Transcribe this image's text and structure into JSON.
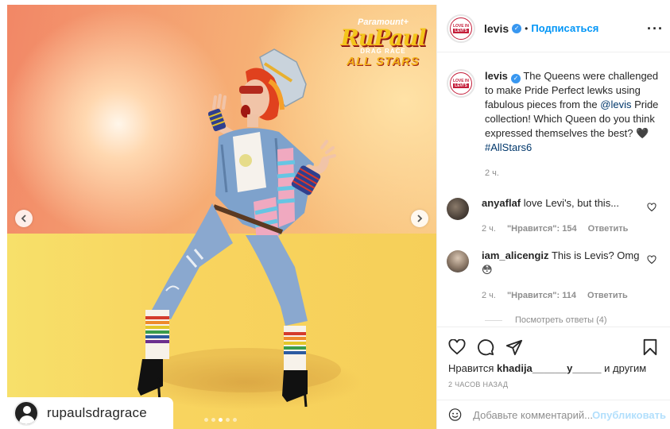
{
  "photo": {
    "logo_top": "Paramount+",
    "logo_main": "RuPaul",
    "logo_sub": "DRAG RACE",
    "logo_allstars": "ALL STARS",
    "tagged_user": "rupaulsdragrace",
    "carousel_count": 5,
    "carousel_active_index": 2
  },
  "header": {
    "username": "levis",
    "separator": "•",
    "follow_label": "Подписаться",
    "more_icon": "more-horizontal-icon",
    "avatar_text_top": "LOVE IN",
    "avatar_text_box": "LEVI'S"
  },
  "caption": {
    "username": "levis",
    "text_1": "The Queens were challenged to make Pride Perfect lewks using fabulous pieces from the ",
    "mention": "@levis",
    "text_2": " Pride collection! Which Queen do you think expressed themselves the best? ",
    "emoji": "🖤",
    "hashtag": "#AllStars6",
    "time": "2 ч."
  },
  "comments": [
    {
      "username": "anyaflaf",
      "text": "love Levi's, but this...",
      "time": "2 ч.",
      "likes": "\"Нравится\": 154",
      "reply": "Ответить"
    },
    {
      "username": "iam_alicengiz",
      "text": "This is Levis? Omg 😳",
      "time": "2 ч.",
      "likes": "\"Нравится\": 114",
      "reply": "Ответить"
    }
  ],
  "view_replies": "Посмотреть ответы (4)",
  "actions": {
    "likes_prefix": "Нравится ",
    "likes_user": "khadija______y_____",
    "likes_suffix": " и другим",
    "date": "2 ЧАСОВ НАЗАД"
  },
  "add_comment": {
    "placeholder": "Добавьте комментарий...",
    "post_label": "Опубликовать"
  },
  "colors": {
    "accent": "#0095f6",
    "verified": "#3897f0",
    "brand_red": "#c41e3a",
    "muted": "#8e8e8e"
  }
}
